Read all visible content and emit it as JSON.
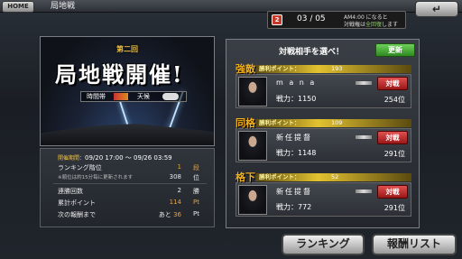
{
  "header": {
    "home_label": "HOME",
    "title": "局地戦",
    "back_icon": "return-arrow-icon"
  },
  "stamina": {
    "icon_label": "2",
    "count": "03 / 05",
    "note_line1": "AM4:00 になると",
    "note_line2_pre": "対戦権は",
    "note_line2_highlight": "全回復",
    "note_line2_post": "します"
  },
  "event": {
    "subtitle": "第二回",
    "title": "局地戦開催!",
    "time_label": "時間帯",
    "weather_label": "天候"
  },
  "info": {
    "period_label": "開催期間：",
    "period_value": "09/20 17:00 ～ 09/26 03:59",
    "ranking_tier_label": "ランキング階位",
    "ranking_tier_value": "1",
    "ranking_tier_unit": "段",
    "ranking_note": "※順位は約15分毎に更新されます",
    "ranking_position": "308",
    "ranking_position_unit": "位",
    "win_streak_label": "連勝回数",
    "win_streak_value": "2",
    "win_streak_unit": "勝",
    "total_points_label": "累計ポイント",
    "total_points_value": "114",
    "total_points_unit": "Pt",
    "next_reward_label": "次の報酬まで",
    "next_reward_prefix": "あと",
    "next_reward_value": "36",
    "next_reward_unit": "Pt"
  },
  "opponents_panel": {
    "title": "対戦相手を選べ！",
    "refresh_label": "更新",
    "points_label": "勝利ポイント：",
    "power_label": "戦力：",
    "battle_label": "対戦",
    "opponents": [
      {
        "rank_class": "強敵",
        "points": "193",
        "name": "m a n a",
        "power": "1150",
        "rank": "254位"
      },
      {
        "rank_class": "同格",
        "points": "109",
        "name": "新任提督",
        "power": "1148",
        "rank": "291位"
      },
      {
        "rank_class": "格下",
        "points": "52",
        "name": "新任提督",
        "power": "772",
        "rank": "291位"
      }
    ]
  },
  "footer": {
    "ranking_label": "ランキング",
    "reward_list_label": "報酬リスト"
  }
}
